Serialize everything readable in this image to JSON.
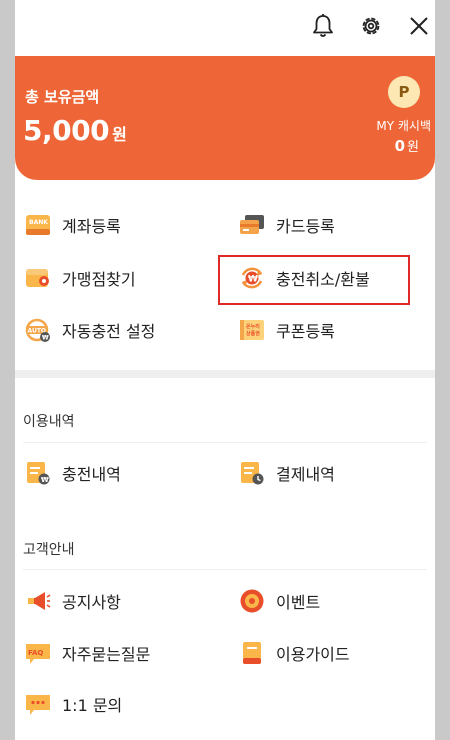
{
  "header": {
    "icons": [
      "bell-icon",
      "gear-icon",
      "close-icon"
    ]
  },
  "balance": {
    "label": "총 보유금액",
    "amount": "5,000",
    "amount_unit": "원",
    "badge_letter": "P",
    "my_cashback_label": "MY 캐시백",
    "my_cashback_amount": "0",
    "my_cashback_unit": "원",
    "accent_color": "#ee6637"
  },
  "quick_menu": [
    {
      "label": "계좌등록",
      "icon": "bank-icon"
    },
    {
      "label": "카드등록",
      "icon": "card-icon"
    },
    {
      "label": "가맹점찾기",
      "icon": "wallet-icon"
    },
    {
      "label": "충전취소/환불",
      "icon": "refund-icon"
    },
    {
      "label": "자동충전 설정",
      "icon": "auto-charge-icon"
    },
    {
      "label": "쿠폰등록",
      "icon": "coupon-icon"
    }
  ],
  "coupon_icon_text": [
    "온누리",
    "상품권"
  ],
  "usage": {
    "title": "이용내역",
    "items": [
      {
        "label": "충전내역",
        "icon": "charge-history-icon"
      },
      {
        "label": "결제내역",
        "icon": "payment-history-icon"
      }
    ]
  },
  "support": {
    "title": "고객안내",
    "items": [
      {
        "label": "공지사항",
        "icon": "megaphone-icon"
      },
      {
        "label": "이벤트",
        "icon": "event-icon"
      },
      {
        "label": "자주묻는질문",
        "icon": "faq-icon"
      },
      {
        "label": "이용가이드",
        "icon": "guide-icon"
      },
      {
        "label": "1:1 문의",
        "icon": "chat-icon"
      }
    ]
  },
  "icon_text": {
    "bank": "BANK",
    "auto": "AUTO",
    "faq": "FAQ",
    "won": "₩"
  },
  "highlight_color": "#e02a2a"
}
